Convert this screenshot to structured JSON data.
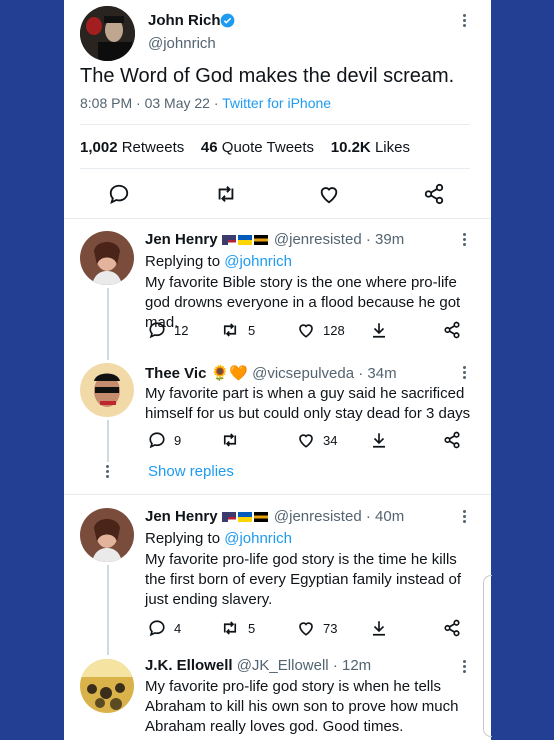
{
  "tweet": {
    "name": "John Rich",
    "handle": "@johnrich",
    "text": "The Word of God makes the devil scream.",
    "time": "8:08 PM · 03 May 22 · ",
    "source": "Twitter for iPhone",
    "stats": {
      "retweets": "1,002",
      "retweets_label": "Retweets",
      "quotes": "46",
      "quotes_label": "Quote Tweets",
      "likes": "10.2K",
      "likes_label": "Likes"
    }
  },
  "replies": [
    {
      "name": "Jen Henry",
      "handle": "@jenresisted",
      "time": "· 39m",
      "replying_label": "Replying to",
      "replying_to": "@johnrich",
      "text": "My favorite Bible story is the one where pro-life god drowns everyone in a flood because he got mad.",
      "replies": "12",
      "retweets": "5",
      "likes": "128"
    },
    {
      "name": "Thee Vic",
      "emoji": "🌻🧡",
      "handle": "@vicsepulveda",
      "time": "· 34m",
      "text": "My favorite part is when a guy said he sacrificed himself for us but could only stay dead for 3 days",
      "replies": "9",
      "retweets": "",
      "likes": "34"
    },
    {
      "name": "Jen Henry",
      "handle": "@jenresisted",
      "time": "· 40m",
      "replying_label": "Replying to",
      "replying_to": "@johnrich",
      "text": "My favorite pro-life god story is the time he kills the first born of every Egyptian family instead of just ending slavery.",
      "replies": "4",
      "retweets": "5",
      "likes": "73"
    },
    {
      "name": "J.K. Ellowell",
      "handle": "@JK_Ellowell",
      "time": "· 12m",
      "text": "My favorite pro-life god story is when he tells Abraham to kill his own son to prove how much Abraham really loves god. Good times."
    }
  ],
  "show_replies": "Show replies",
  "colors": {
    "background": "#233f93",
    "accent": "#1d9bf0",
    "text": "#0f1419",
    "muted": "#536471"
  }
}
